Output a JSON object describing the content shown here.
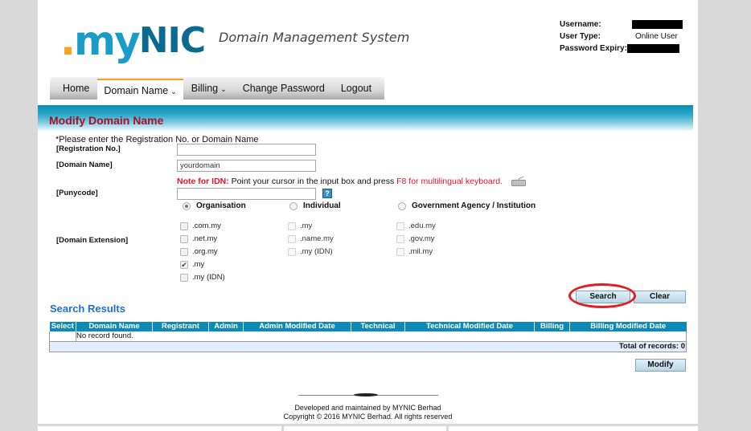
{
  "header": {
    "logo": {
      "dot": ".",
      "my": "my",
      "nic": "NIC"
    },
    "tagline": "Domain Management System",
    "user_info": [
      {
        "label": "Username:",
        "value": null,
        "redacted": true
      },
      {
        "label": "User Type:",
        "value": "Online User",
        "redacted": false
      },
      {
        "label": "Password Expiry:",
        "value": null,
        "redacted": true
      }
    ]
  },
  "nav": {
    "items": [
      {
        "label": "Home",
        "dropdown": false,
        "active": false
      },
      {
        "label": "Domain Name",
        "dropdown": true,
        "active": true
      },
      {
        "label": "Billing",
        "dropdown": true,
        "active": false
      },
      {
        "label": "Change Password",
        "dropdown": false,
        "active": false
      },
      {
        "label": "Logout",
        "dropdown": false,
        "active": false
      }
    ],
    "caret": "⌵"
  },
  "section": {
    "title": "Modify Domain Name"
  },
  "form": {
    "instruction": "*Please enter the Registration No. or Domain Name",
    "registration_no": {
      "label": "[Registration No.]",
      "value": "",
      "placeholder": ""
    },
    "domain_name": {
      "label": "[Domain Name]",
      "value": "yourdomain"
    },
    "idn_note": {
      "prefix": "Note for IDN:",
      "text": " Point your cursor in the input box and press ",
      "suffix": "F8 for multilingual keyboard."
    },
    "punycode": {
      "label": "[Punycode]",
      "value": "",
      "help": "?"
    },
    "domain_extension_label": "[Domain Extension]",
    "categories": [
      {
        "label": "Organisation",
        "selected": true
      },
      {
        "label": "Individual",
        "selected": false
      },
      {
        "label": "Government Agency / Institution",
        "selected": false
      }
    ],
    "extensions": {
      "organisation": [
        {
          "label": ".com.my",
          "checked": false
        },
        {
          "label": ".net.my",
          "checked": false
        },
        {
          "label": ".org.my",
          "checked": false
        },
        {
          "label": ".my",
          "checked": true
        },
        {
          "label": ".my (IDN)",
          "checked": false
        }
      ],
      "individual": [
        {
          "label": ".my",
          "checked": false
        },
        {
          "label": ".name.my",
          "checked": false
        },
        {
          "label": ".my (IDN)",
          "checked": false
        }
      ],
      "government": [
        {
          "label": ".edu.my",
          "checked": false
        },
        {
          "label": ".gov.my",
          "checked": false
        },
        {
          "label": ".mil.my",
          "checked": false
        }
      ]
    },
    "buttons": {
      "search": "Search",
      "clear": "Clear"
    }
  },
  "results": {
    "title": "Search Results",
    "columns": [
      "Select",
      "Domain Name",
      "Registrant",
      "Admin",
      "Admin Modified Date",
      "Technical",
      "Technical Modified Date",
      "Billing",
      "Billing Modified Date"
    ],
    "empty_message": "No record found.",
    "total_label": "Total of records: 0",
    "modify_button": "Modify"
  },
  "footer": {
    "line1": "Developed and maintained by MYNIC Berhad",
    "line2": "Copyright © 2016 MYNIC Berhad. All rights reserved"
  },
  "colors": {
    "accent_red": "#a8102a",
    "header_blue": "#0d8ab8",
    "results_title": "#1b6fd6",
    "note_red": "#e3132a",
    "highlight_ring": "#e31b23"
  }
}
